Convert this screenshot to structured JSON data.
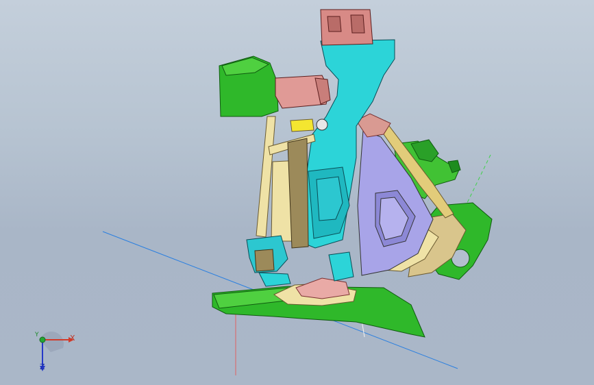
{
  "viewport": {
    "background_top": "#c4cfdb",
    "background_bottom": "#aab7c8"
  },
  "model": {
    "part_colors": {
      "green": "#2fb82a",
      "cyan": "#2cd4d8",
      "pink": "#e09a96",
      "cream": "#efe2a6",
      "lavender": "#a8a4e8",
      "yellow": "#f4e630",
      "olive": "#9c8a5a"
    }
  },
  "triad": {
    "x_label": "X",
    "y_label": "Y",
    "z_label": "Z",
    "x_color": "#d23b2a",
    "y_color": "#25a533",
    "z_color": "#2538c8"
  }
}
